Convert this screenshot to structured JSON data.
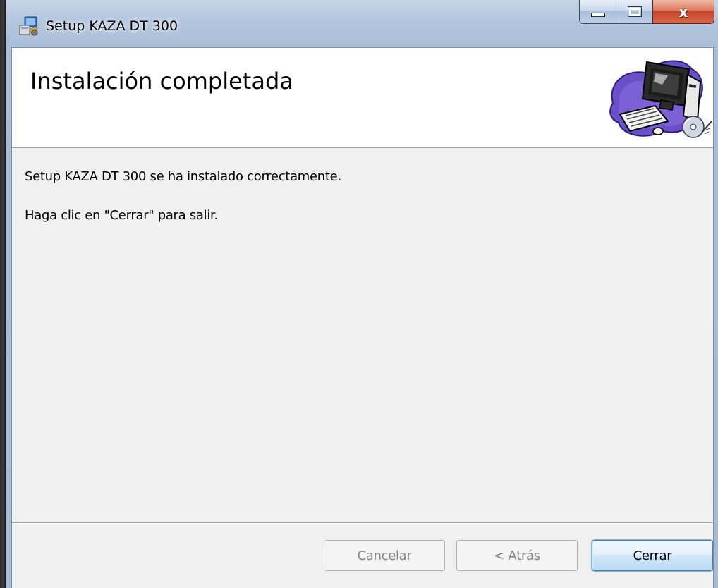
{
  "window": {
    "title": "Setup KAZA DT 300",
    "app_icon": "installer-icon",
    "caption_buttons": {
      "minimize": "minimize-icon",
      "maximize": "maximize-icon",
      "close_label": "x"
    }
  },
  "banner": {
    "title": "Instalación completada",
    "art": "computer-setup-illustration"
  },
  "body": {
    "message_line_1": "Setup KAZA DT 300 se ha instalado correctamente.",
    "message_line_2": "Haga clic en \"Cerrar\" para salir."
  },
  "footer": {
    "cancel_label": "Cancelar",
    "back_label": "< Atrás",
    "close_label": "Cerrar",
    "cancel_enabled": false,
    "back_enabled": false,
    "close_enabled": true
  },
  "colors": {
    "client_background": "#f0f0f0",
    "banner_background": "#ffffff",
    "close_caption_red": "#c7432a",
    "default_button_border": "#3c7fb1",
    "disabled_text": "#838383"
  }
}
